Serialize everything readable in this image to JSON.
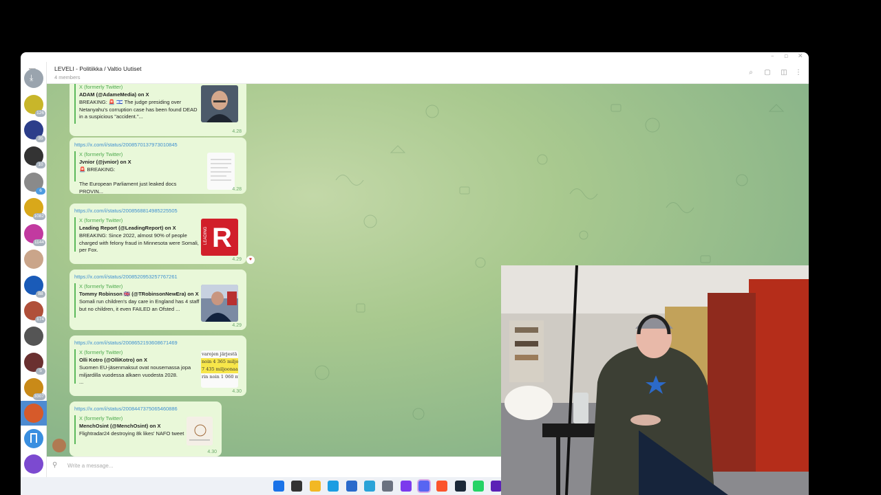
{
  "window": {
    "title": "LEVELI - Politiikka / Valtio Uutiset",
    "subtitle": "4 members",
    "controls": [
      "–",
      "▫",
      "✕"
    ]
  },
  "sidebar": {
    "items": [
      {
        "name": "archive",
        "badge": "",
        "color": "#9aa4ae"
      },
      {
        "name": "chat-1",
        "badge": "126",
        "color": "#c8b62a"
      },
      {
        "name": "chat-2",
        "badge": "35",
        "color": "#2c3e8a"
      },
      {
        "name": "chat-3",
        "badge": "10",
        "color": "#333333"
      },
      {
        "name": "chat-4",
        "badge": "6",
        "color": "#8a8a8a"
      },
      {
        "name": "chat-5",
        "badge": "1082",
        "color": "#d9a81a"
      },
      {
        "name": "chat-6",
        "badge": "1144",
        "color": "#c23aa0"
      },
      {
        "name": "chat-7",
        "badge": "",
        "color": "#caa58a"
      },
      {
        "name": "chat-8",
        "badge": "88",
        "color": "#1a5bb8"
      },
      {
        "name": "chat-9",
        "badge": "174",
        "color": "#b0503a"
      },
      {
        "name": "chat-10",
        "badge": "",
        "color": "#555555"
      },
      {
        "name": "chat-11",
        "badge": "5",
        "color": "#6a3030"
      },
      {
        "name": "chat-12",
        "badge": "3307",
        "color": "#c98a18"
      },
      {
        "name": "chat-13-active",
        "badge": "",
        "color": "#d65a2a"
      },
      {
        "name": "saved",
        "badge": "",
        "color": "#3a8fe0"
      },
      {
        "name": "chat-15",
        "badge": "",
        "color": "#7c4ad0"
      }
    ]
  },
  "header_icons": [
    "search-icon",
    "comments-icon",
    "sidebar-toggle-icon",
    "more-icon"
  ],
  "messages": [
    {
      "link": "",
      "source": "X (formerly Twitter)",
      "author": "ADAM (@AdameMedia) on X",
      "text": "BREAKING: 🚨 🇮🇱 The judge presiding over Netanyahu's corruption case has been found DEAD in a suspicious \"accident.\"...",
      "time": "4.28"
    },
    {
      "link": "https://x.com/i/status/2008570137973010845",
      "source": "X (formerly Twitter)",
      "author": "Jvnior (@jvnior) on X",
      "text": "🚨 BREAKING:\n\nThe European Parliament just leaked docs PROVIN...",
      "time": "4.28"
    },
    {
      "link": "https://x.com/i/status/2008568814985225505",
      "source": "X (formerly Twitter)",
      "author": "Leading Report (@LeadingReport) on X",
      "text": "BREAKING: Since 2022, almost 90% of people charged with felony fraud in Minnesota were Somali, per Fox.",
      "time": "4.29"
    },
    {
      "link": "https://x.com/i/status/2008520953257767261",
      "source": "X (formerly Twitter)",
      "author": "Tommy Robinson 🇬🇧 (@TRobinsonNewEra) on X",
      "text": "Somali run children's day care in England has 4 staff but no children, it even FAILED an Ofsted ...",
      "time": "4.29"
    },
    {
      "link": "https://x.com/i/status/2008652193608671469",
      "source": "X (formerly Twitter)",
      "author": "Olli Kotro (@OlliKotro) on X",
      "text": "Suomen EU-jäsenmaksut ovat nousemassa jopa miljardilla vuodessa alkaen vuodesta 2028.\n...",
      "time": "4.30",
      "thumb_lines": [
        "varojen järjestä",
        "noin 4 365 miljoo",
        "7 435 miljoonaa",
        "rin noin 1 060 m"
      ]
    },
    {
      "link": "https://x.com/i/status/2008447375065460886",
      "source": "X (formerly Twitter)",
      "author": "MenchOsint (@MenchOsint) on X",
      "text": "Flightradar24 destroying 8k likes' NAFO tweet",
      "time": "4.30"
    }
  ],
  "reaction": "♥",
  "input": {
    "placeholder": "Write a message..."
  },
  "thumb_logo_letter": "R",
  "thumb_logo_text": "LEADING",
  "taskbar": {
    "icons": [
      {
        "name": "windows-start-icon",
        "color": "#1a73e8"
      },
      {
        "name": "task-view-icon",
        "color": "#333333"
      },
      {
        "name": "file-explorer-icon",
        "color": "#f2b824"
      },
      {
        "name": "edge-icon",
        "color": "#1b9de2"
      },
      {
        "name": "store-icon",
        "color": "#2a6acb"
      },
      {
        "name": "snipping-icon",
        "color": "#2aa3d8"
      },
      {
        "name": "settings-icon",
        "color": "#6b7280"
      },
      {
        "name": "app-purple-icon",
        "color": "#7c3aed"
      },
      {
        "name": "discord-icon",
        "color": "#5865f2"
      },
      {
        "name": "brave-icon",
        "color": "#fb542b"
      },
      {
        "name": "steam-icon",
        "color": "#1b2838"
      },
      {
        "name": "whatsapp-icon",
        "color": "#25d366"
      },
      {
        "name": "app-last-icon",
        "color": "#5b21b6"
      }
    ]
  }
}
